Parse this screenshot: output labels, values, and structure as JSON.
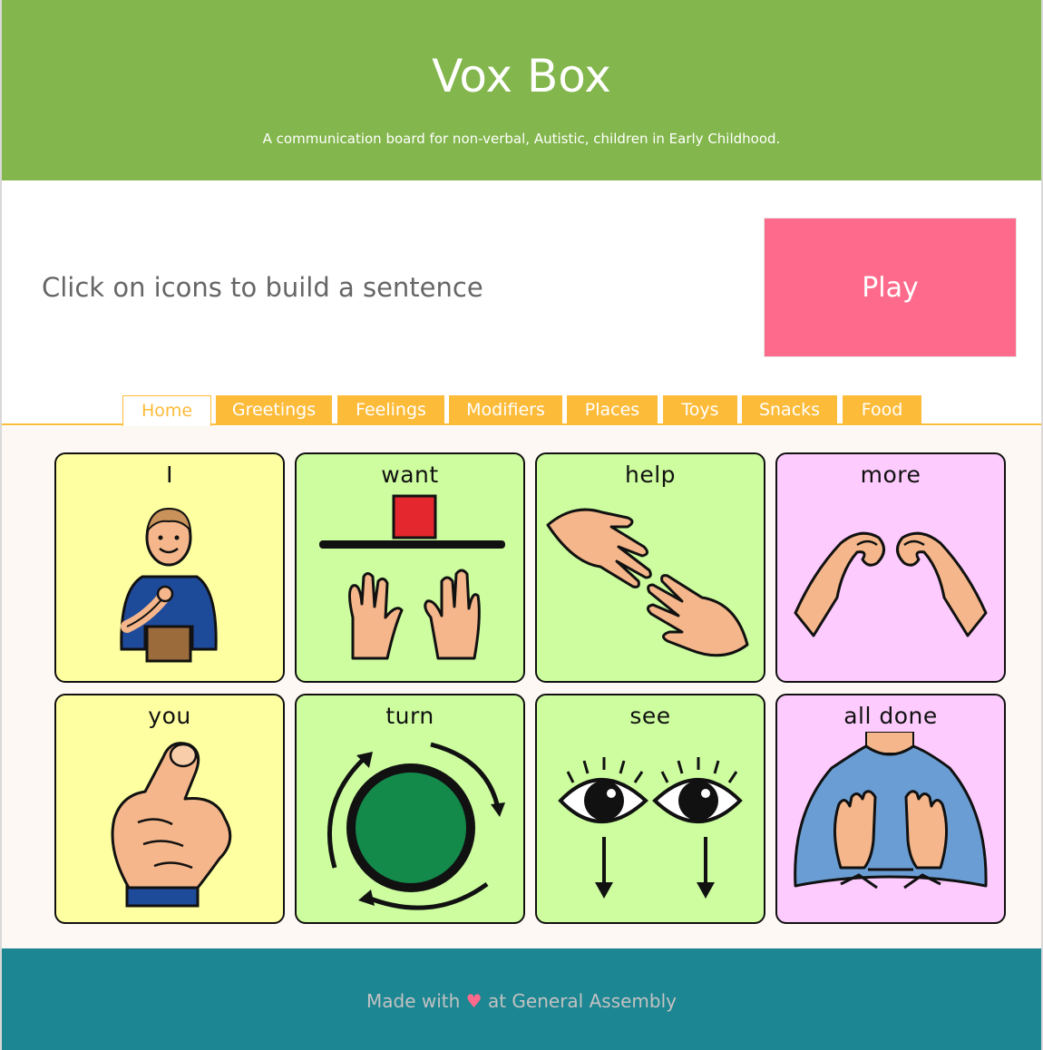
{
  "header": {
    "title": "Vox Box",
    "subtitle": "A communication board for non-verbal, Autistic, children in Early Childhood."
  },
  "sentence": {
    "placeholder": "Click on icons to build a sentence"
  },
  "play_button": {
    "label": "Play"
  },
  "tabs": [
    {
      "label": "Home",
      "active": true
    },
    {
      "label": "Greetings"
    },
    {
      "label": "Feelings"
    },
    {
      "label": "Modifiers"
    },
    {
      "label": "Places"
    },
    {
      "label": "Toys"
    },
    {
      "label": "Snacks"
    },
    {
      "label": "Food"
    }
  ],
  "cards": [
    {
      "word": "I",
      "color": "#feffa1",
      "icon": "person-pointing-self-icon"
    },
    {
      "word": "want",
      "color": "#cdfd9f",
      "icon": "hands-reaching-icon"
    },
    {
      "word": "help",
      "color": "#cdfd9f",
      "icon": "helping-hands-icon"
    },
    {
      "word": "more",
      "color": "#fdcbfd",
      "icon": "more-sign-hands-icon"
    },
    {
      "word": "you",
      "color": "#feffa1",
      "icon": "pointing-finger-icon"
    },
    {
      "word": "turn",
      "color": "#cdfd9f",
      "icon": "circular-arrows-icon"
    },
    {
      "word": "see",
      "color": "#cdfd9f",
      "icon": "eyes-looking-icon"
    },
    {
      "word": "all done",
      "color": "#fdcbfd",
      "icon": "all-done-sign-icon"
    }
  ],
  "footer": {
    "prefix": "Made with",
    "heart": "♥",
    "suffix": "at General Assembly"
  },
  "colors": {
    "header_bg": "#83b64c",
    "play_bg": "#fe6a8b",
    "tab_bg": "#fdbb3a",
    "footer_bg": "#1c8692"
  }
}
